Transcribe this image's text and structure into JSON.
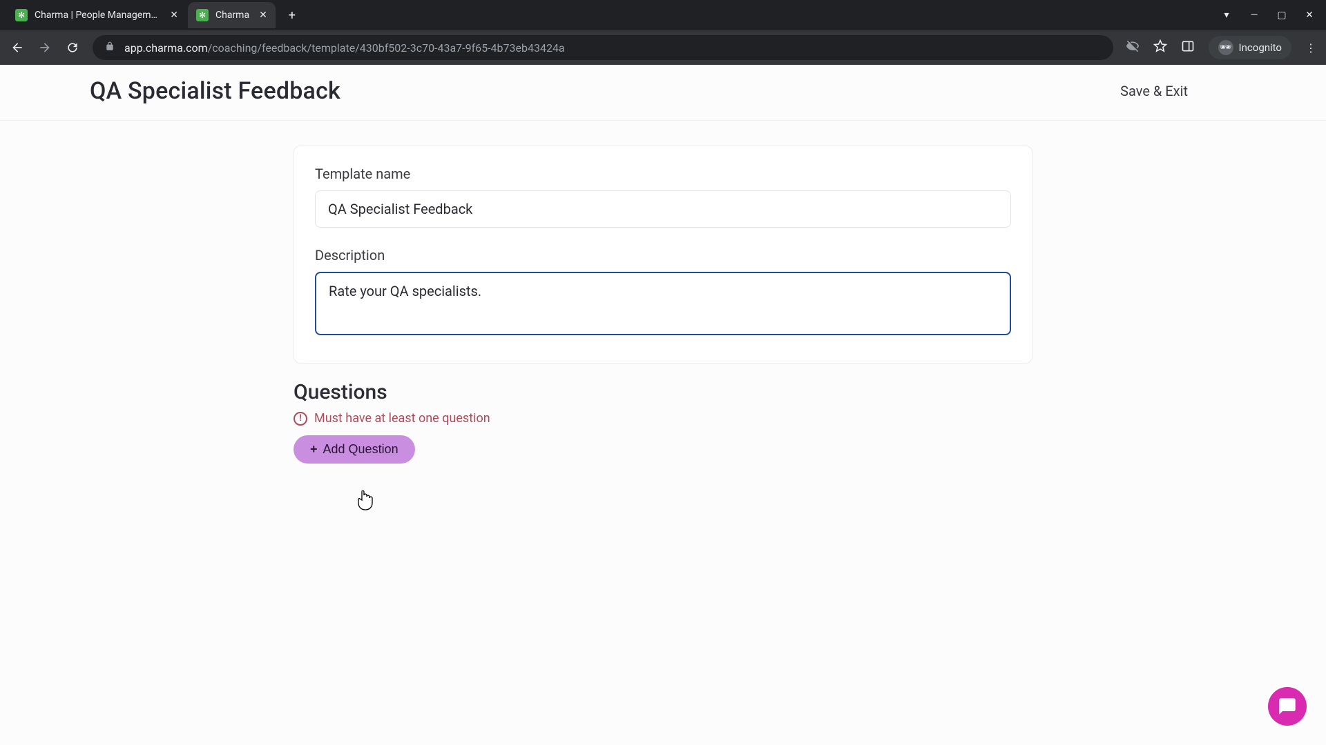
{
  "browser": {
    "tabs": [
      {
        "title": "Charma | People Management S",
        "active": false
      },
      {
        "title": "Charma",
        "active": true
      }
    ],
    "url_host": "app.charma.com",
    "url_path": "/coaching/feedback/template/430bf502-3c70-43a7-9f65-4b73eb43424a",
    "incognito_label": "Incognito"
  },
  "page": {
    "title": "QA Specialist Feedback",
    "save_exit_label": "Save & Exit",
    "template_name_label": "Template name",
    "template_name_value": "QA Specialist Feedback",
    "description_label": "Description",
    "description_value": "Rate your QA specialists.",
    "questions_heading": "Questions",
    "questions_warning": "Must have at least one question",
    "add_question_label": "Add Question"
  }
}
